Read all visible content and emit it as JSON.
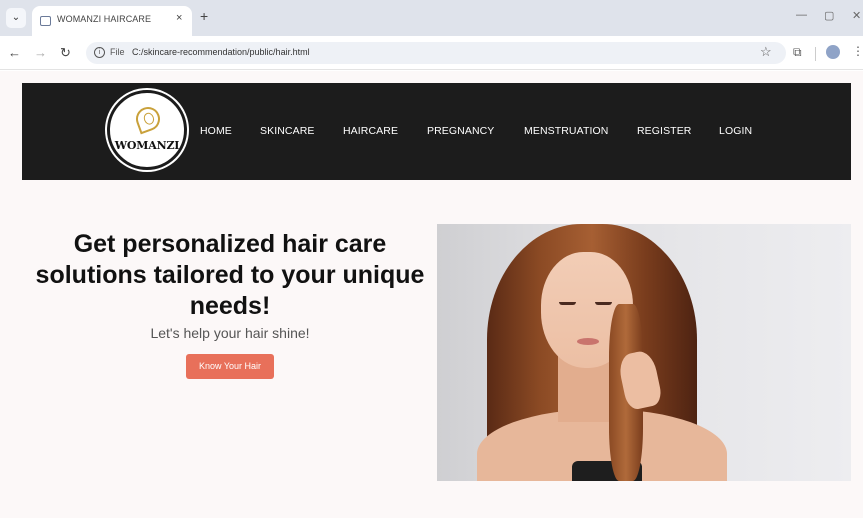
{
  "browser": {
    "tab_title": "WOMANZI HAIRCARE",
    "tab_close": "×",
    "new_tab": "+",
    "url_scheme": "File",
    "url": "C:/skincare-recommendation/public/hair.html",
    "icons": [
      "tab-menu-icon",
      "page-icon",
      "back-icon",
      "forward-icon",
      "reload-icon",
      "info-icon",
      "star-icon",
      "extensions-icon",
      "profile-icon",
      "kebab-menu-icon",
      "minimize-icon",
      "maximize-icon",
      "close-window-icon"
    ]
  },
  "header": {
    "logo_text": "WOMANZI",
    "nav": [
      {
        "label": "HOME"
      },
      {
        "label": "SKINCARE"
      },
      {
        "label": "HAIRCARE"
      },
      {
        "label": "PREGNANCY"
      },
      {
        "label": "MENSTRUATION"
      },
      {
        "label": "REGISTER"
      },
      {
        "label": "LOGIN"
      }
    ]
  },
  "hero": {
    "headline": "Get personalized hair care solutions tailored to your unique needs!",
    "subline": "Let's help your hair shine!",
    "cta_label": "Know Your Hair"
  },
  "colors": {
    "header_bg": "#1c1c1c",
    "cta_bg": "#e8705a",
    "page_bg": "#fcf8f8",
    "logo_accent": "#c9a13b"
  }
}
